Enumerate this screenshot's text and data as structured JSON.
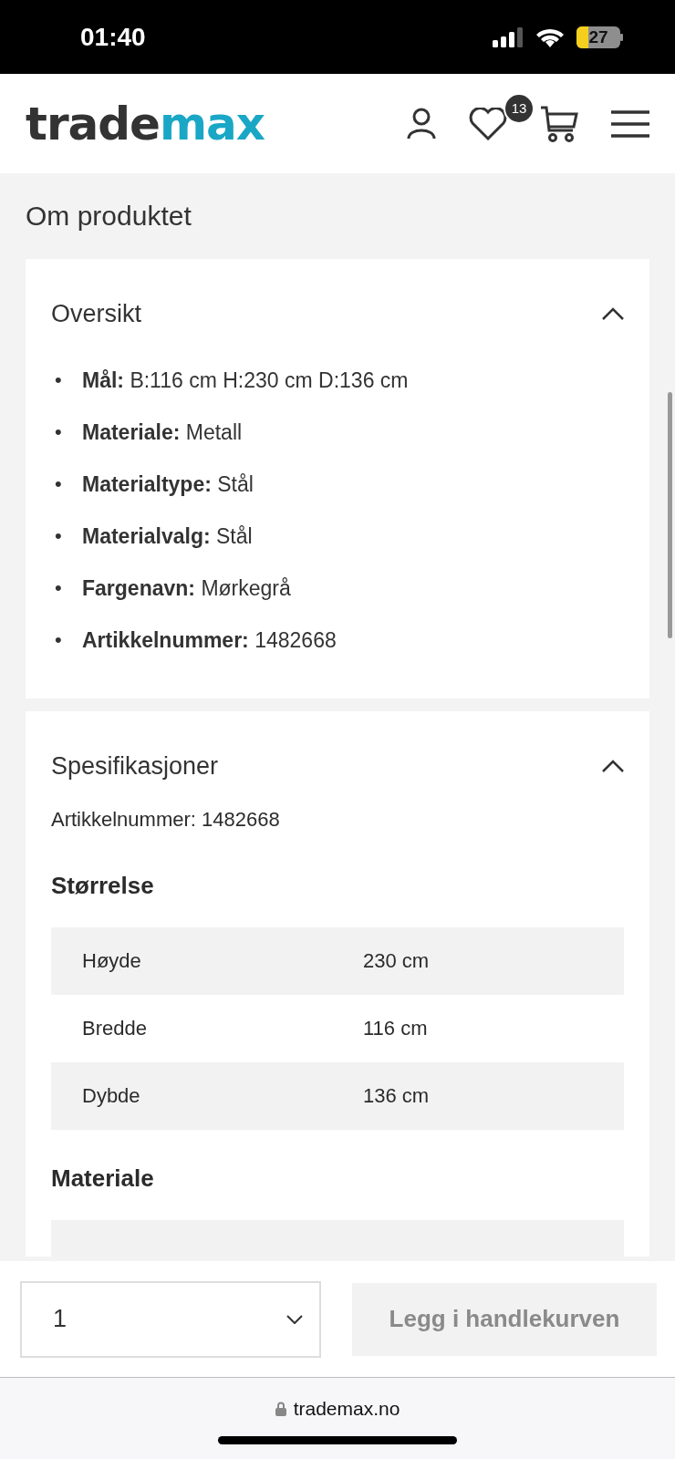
{
  "status_bar": {
    "time": "01:40",
    "battery": "27"
  },
  "header": {
    "logo_main": "trade",
    "logo_accent": "max",
    "wishlist_count": "13"
  },
  "section_title": "Om produktet",
  "accordions": [
    {
      "kind": "list",
      "title": "Oversikt",
      "expanded": true,
      "items": [
        {
          "bullet": "•",
          "label": "Mål:",
          "value": "B:116 cm H:230 cm D:136 cm"
        },
        {
          "bullet": "•",
          "label": "Materiale:",
          "value": "Metall"
        },
        {
          "bullet": "•",
          "label": "Materialtype:",
          "value": "Stål"
        },
        {
          "bullet": "•",
          "label": "Materialvalg:",
          "value": "Stål"
        },
        {
          "bullet": "•",
          "label": "Fargenavn:",
          "value": "Mørkegrå"
        },
        {
          "bullet": "•",
          "label": "Artikkelnummer:",
          "value": "1482668"
        }
      ]
    },
    {
      "kind": "specs",
      "title": "Spesifikasjoner",
      "expanded": true,
      "article": "Artikkelnummer: 1482668",
      "groups": [
        {
          "heading": "Størrelse",
          "rows": [
            {
              "name": "Høyde",
              "value": "230 cm"
            },
            {
              "name": "Bredde",
              "value": "116 cm"
            },
            {
              "name": "Dybde",
              "value": "136 cm"
            }
          ]
        },
        {
          "heading": "Materiale"
        }
      ]
    }
  ],
  "cart_bar": {
    "quantity": "1",
    "button": "Legg i handlekurven",
    "button_disabled": true
  },
  "browser": {
    "url": "trademax.no"
  }
}
